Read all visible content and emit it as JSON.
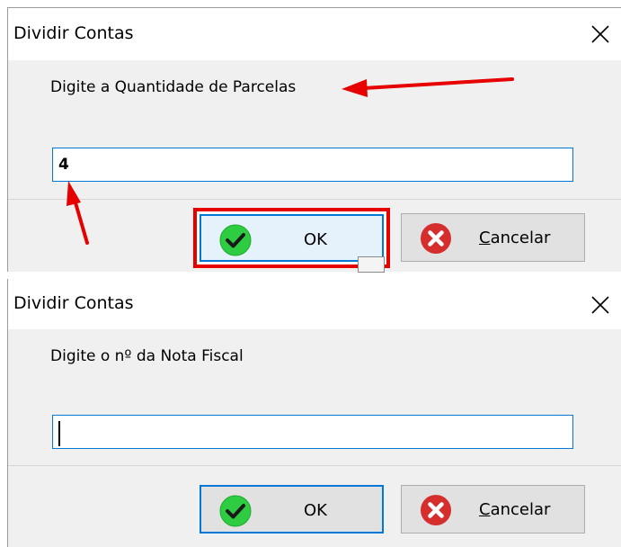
{
  "dialog_quantity": {
    "title": "Dividir Contas",
    "prompt": "Digite a Quantidade de Parcelas",
    "input_value": "4",
    "ok_label": "OK",
    "cancel_label_first": "C",
    "cancel_label_rest": "ancelar"
  },
  "dialog_invoice": {
    "title": "Dividir Contas",
    "prompt": "Digite o nº da Nota Fiscal",
    "input_value": "",
    "ok_label": "OK",
    "cancel_label_first": "C",
    "cancel_label_rest": "ancelar"
  },
  "colors": {
    "annotation": "#e60000",
    "focus_border": "#0078d7",
    "ok_icon": "#2ecc40",
    "cancel_icon": "#d62d2d"
  },
  "icons": {
    "close": "close-icon",
    "ok": "check-circle-icon",
    "cancel": "x-circle-icon"
  }
}
